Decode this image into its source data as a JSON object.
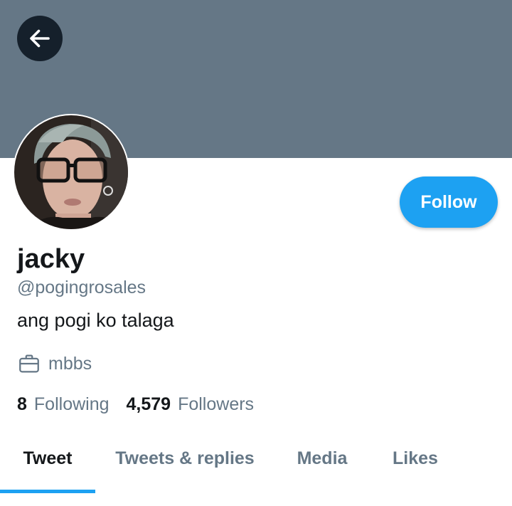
{
  "header": {
    "back_icon": "arrow-left-icon",
    "banner_color": "#657786"
  },
  "profile": {
    "avatar_icon": "profile-photo",
    "display_name": "jacky",
    "handle": "@pogingrosales",
    "bio": "ang pogi ko talaga",
    "occupation_icon": "briefcase-icon",
    "occupation": "mbbs",
    "follow_label": "Follow",
    "accent_color": "#1da1f2"
  },
  "stats": {
    "following_count": "8",
    "following_label": "Following",
    "followers_count": "4,579",
    "followers_label": "Followers"
  },
  "tabs": [
    {
      "label": "Tweet",
      "active": true
    },
    {
      "label": "Tweets & replies",
      "active": false
    },
    {
      "label": "Media",
      "active": false
    },
    {
      "label": "Likes",
      "active": false
    }
  ]
}
